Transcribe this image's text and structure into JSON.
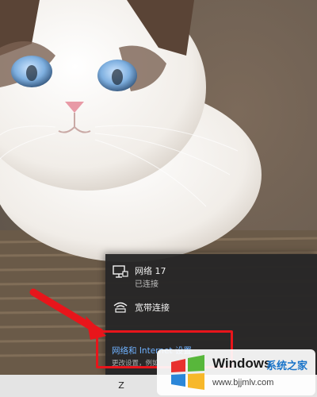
{
  "flyout": {
    "networks": [
      {
        "name": "网络 17",
        "status": "已连接",
        "icon": "ethernet-monitor-icon"
      },
      {
        "name": "宽带连接",
        "status": "",
        "icon": "dialup-connection-icon"
      }
    ],
    "settings_link": "网络和 Internet 设置",
    "settings_desc": "更改设置，例如"
  },
  "taskbar": {
    "tray_icon": "ime-icon",
    "tray_glyph": "Z"
  },
  "watermark": {
    "brand": "Windows",
    "brand_cn": "系统之家",
    "url": "www.bjjmlv.com"
  },
  "colors": {
    "flyout_bg": "#262626",
    "link_blue": "#6fb2ff",
    "annotation_red": "#e8151b",
    "taskbar_bg": "#e4e4e4"
  }
}
